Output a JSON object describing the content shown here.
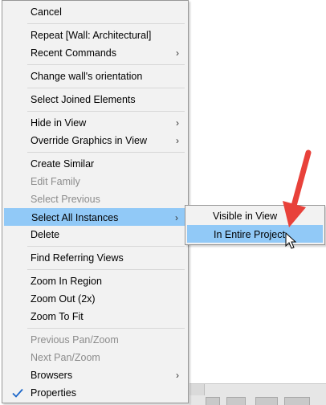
{
  "context_menu": {
    "items": [
      {
        "label": "Cancel"
      },
      {
        "label": "Repeat [Wall: Architectural]"
      },
      {
        "label": "Recent Commands",
        "submenu_arrow": "›"
      },
      {
        "label": "Change wall's orientation"
      },
      {
        "label": "Select Joined Elements"
      },
      {
        "label": "Hide in View",
        "submenu_arrow": "›"
      },
      {
        "label": "Override Graphics in View",
        "submenu_arrow": "›"
      },
      {
        "label": "Create Similar"
      },
      {
        "label": "Edit Family",
        "disabled": true
      },
      {
        "label": "Select Previous",
        "disabled": true
      },
      {
        "label": "Select All Instances",
        "submenu_arrow": "›",
        "highlighted": true
      },
      {
        "label": "Delete"
      },
      {
        "label": "Find Referring Views"
      },
      {
        "label": "Zoom In Region"
      },
      {
        "label": "Zoom Out (2x)"
      },
      {
        "label": "Zoom To Fit"
      },
      {
        "label": "Previous Pan/Zoom",
        "disabled": true
      },
      {
        "label": "Next Pan/Zoom",
        "disabled": true
      },
      {
        "label": "Browsers",
        "submenu_arrow": "›"
      },
      {
        "label": "Properties",
        "checked": true
      }
    ]
  },
  "submenu": {
    "items": [
      {
        "label": "Visible in View"
      },
      {
        "label": "In Entire Project",
        "highlighted": true
      }
    ]
  },
  "colors": {
    "highlight": "#91c9f7",
    "annotation_arrow": "#e8413a",
    "menu_background": "#f2f2f2",
    "disabled_text": "#8c8c8c"
  },
  "icons": {
    "check": "checkmark-icon",
    "submenu": "chevron-right-icon",
    "cursor": "mouse-pointer-icon",
    "annotation": "red-arrow-icon"
  }
}
